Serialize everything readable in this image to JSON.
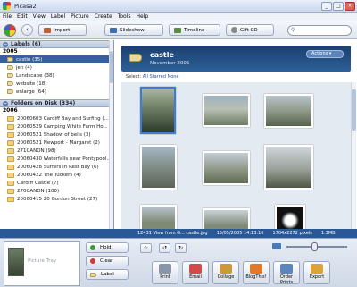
{
  "window": {
    "title": "Picasa2",
    "minimize": "_",
    "maximize": "□",
    "close": "×"
  },
  "menu": [
    "File",
    "Edit",
    "View",
    "Label",
    "Picture",
    "Create",
    "Tools",
    "Help"
  ],
  "toolbar": {
    "back": "‹",
    "import": "Import",
    "slideshow": "Slideshow",
    "timeline": "Timeline",
    "gift_cd": "Gift CD",
    "search_placeholder": ""
  },
  "sidebar": {
    "labels_header": "Labels (6)",
    "labels_year": "2005",
    "labels": [
      {
        "text": "castle (35)",
        "selected": true
      },
      {
        "text": "jen (4)"
      },
      {
        "text": "Landscape (38)"
      },
      {
        "text": "website (18)"
      },
      {
        "text": "enlarge (64)"
      }
    ],
    "folders_header": "Folders on Disk (334)",
    "folders_year": "2006",
    "folders": [
      "20060603 Cardiff Bay and Surfing (...",
      "20060529 Camping White Farm Ho...",
      "20060521 Shadow of bells (3)",
      "20060521 Newport - Margaret (2)",
      "271CANON (98)",
      "20060430 Waterfalls near Pontypool...",
      "20060428 Surfers in Rest Bay (6)",
      "20060422 The Tuckers (4)",
      "Cardiff Castle (7)",
      "270CANON (100)",
      "20060415 20 Gordon Street (27)"
    ]
  },
  "album": {
    "name": "castle",
    "date": "November 2005",
    "actions": "Actions",
    "select_label": "Select:",
    "select_all": "All",
    "select_starred": "Starred",
    "select_none": "None"
  },
  "status": {
    "file": "12431 View from G... castle.jpg",
    "datetime": "15/05/2005 14:13:16",
    "dimensions": "1704x2272 pixels",
    "size": "1.3MB"
  },
  "tray": {
    "preview_label": "Picture Tray",
    "hold": "Hold",
    "clear": "Clear",
    "label": "Label",
    "rotate_left": "↺",
    "rotate_right": "↻",
    "star": "☆",
    "buttons": [
      "Print",
      "Email",
      "Collage",
      "BlogThis!",
      "Order Prints",
      "Export"
    ]
  },
  "colors": {
    "accent": "#2a5896",
    "selection": "#36609c"
  }
}
